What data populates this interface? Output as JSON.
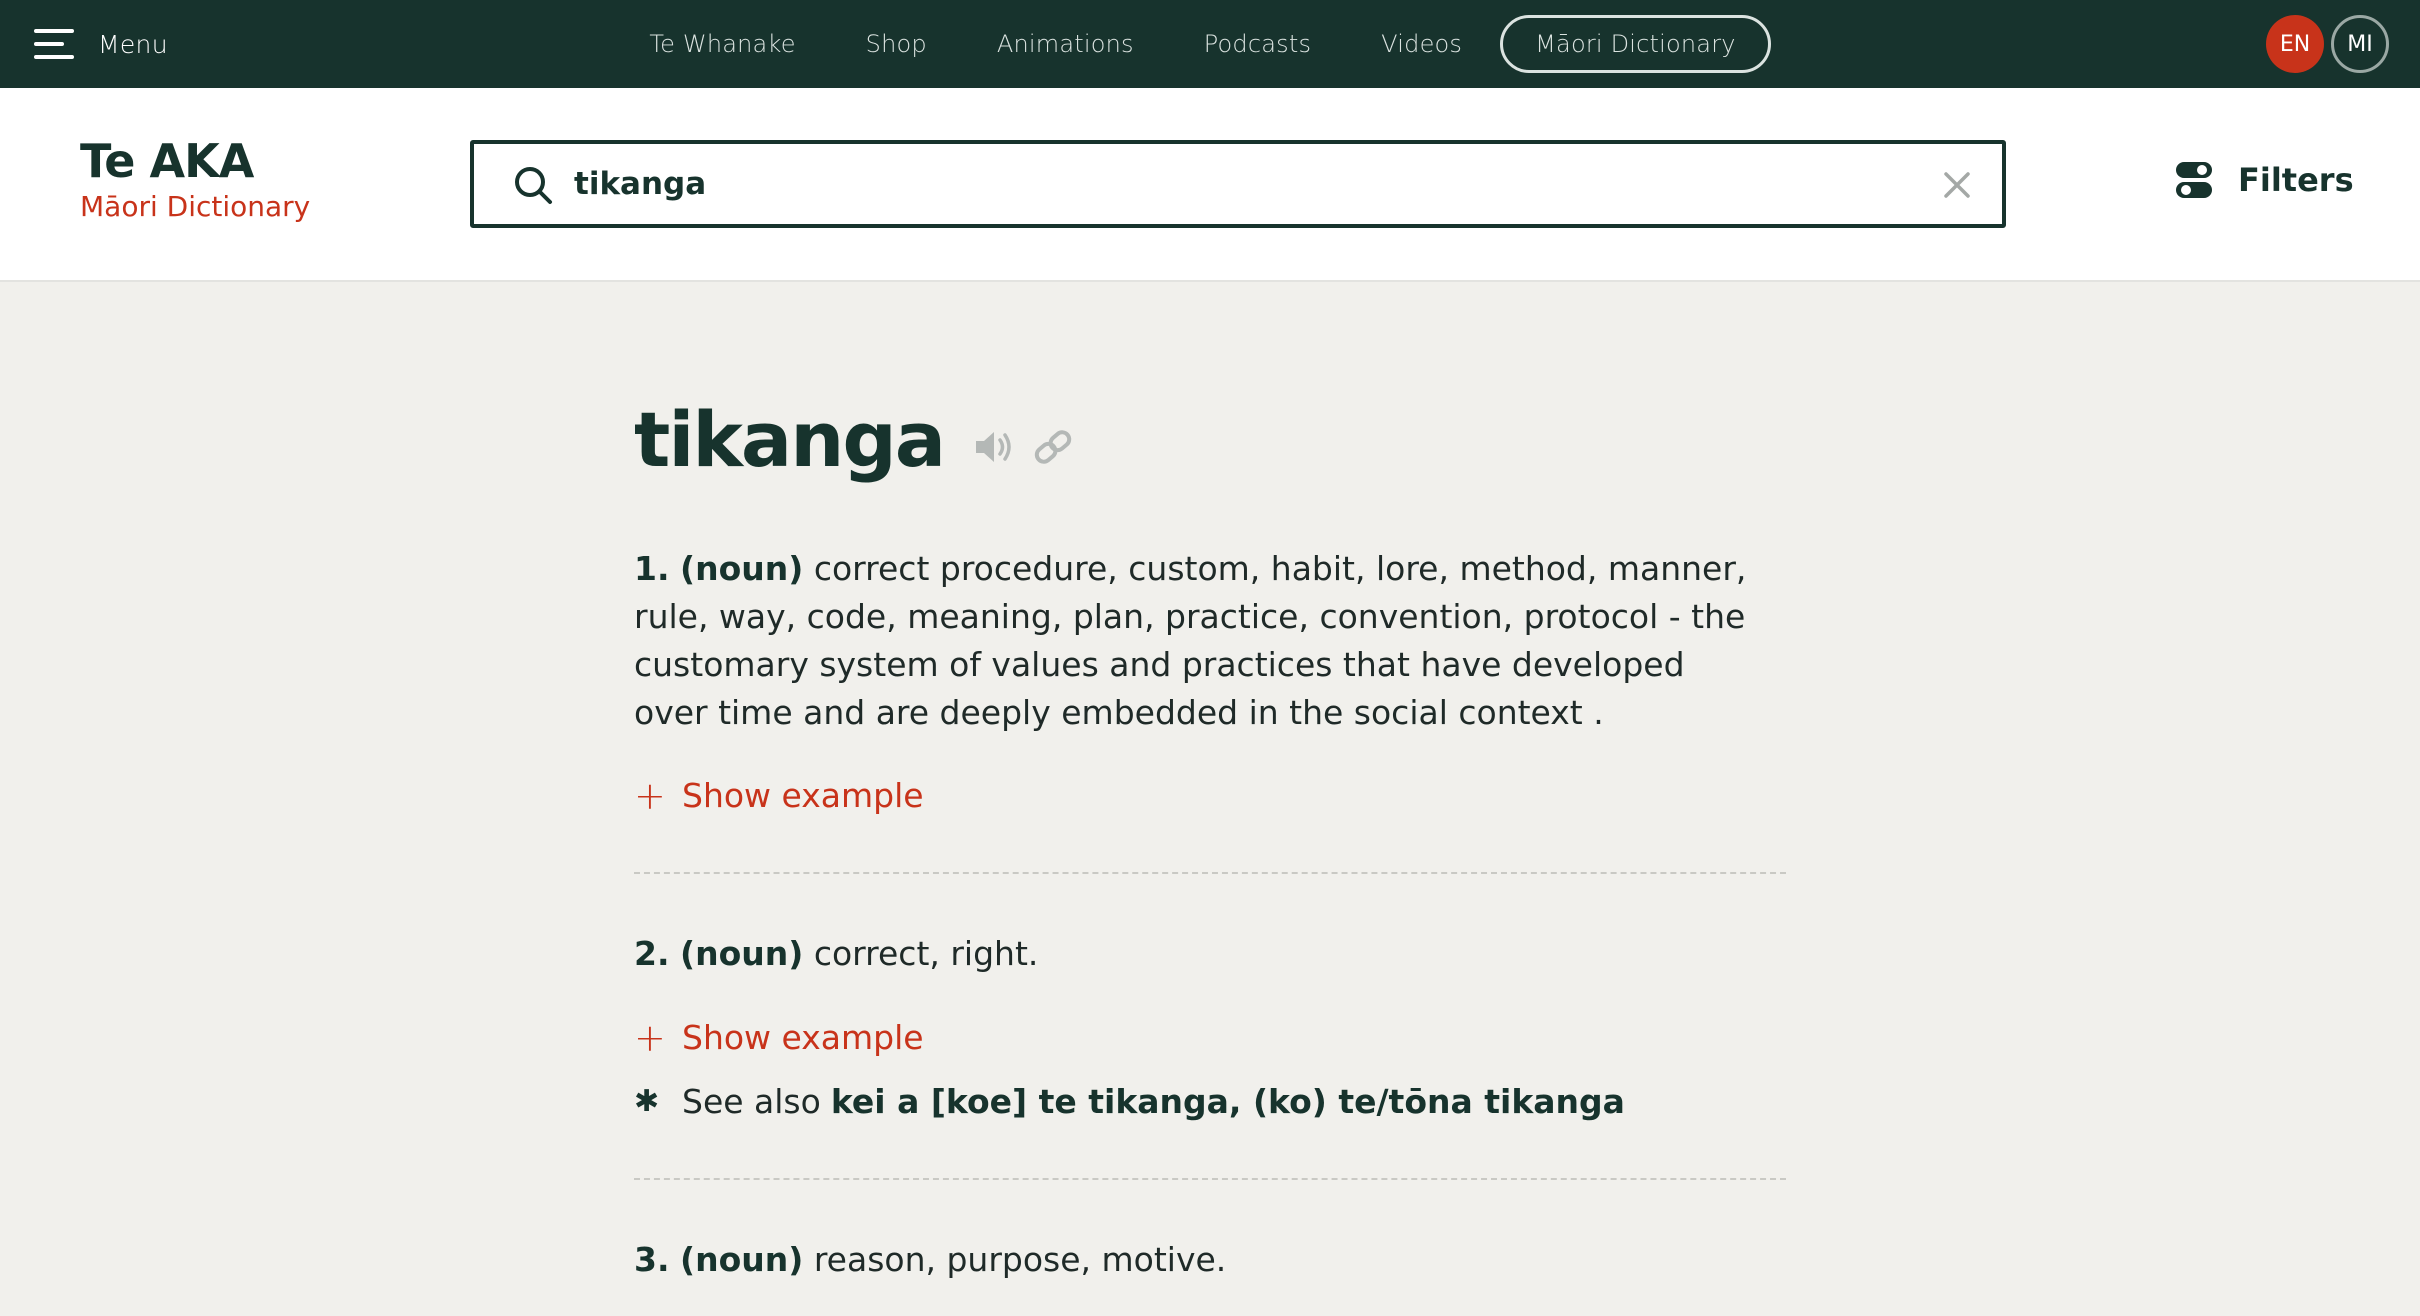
{
  "topnav": {
    "menu_label": "Menu",
    "links": [
      "Te Whanake",
      "Shop",
      "Animations",
      "Podcasts",
      "Videos"
    ],
    "dictionary_pill": "Māori Dictionary",
    "lang_en": "EN",
    "lang_mi": "MI",
    "colors": {
      "background": "#17332d",
      "active_lang": "#c8331a"
    }
  },
  "header": {
    "logo_main": "Te AKA",
    "logo_sub": "Māori Dictionary",
    "search_value": "tikanga",
    "filters_label": "Filters",
    "icons": [
      "search-icon",
      "clear-icon",
      "toggle-filters-icon"
    ]
  },
  "entry": {
    "headword": "tikanga",
    "headword_icons": [
      "speaker-icon",
      "link-icon"
    ],
    "senses": [
      {
        "number": "1.",
        "pos": "(noun)",
        "definition": "correct procedure, custom, habit, lore, method, manner, rule, way, code, meaning, plan, practice, convention, protocol - the customary system of values and practices that have developed over time and are deeply embedded in the social context .",
        "show_example": "Show example"
      },
      {
        "number": "2.",
        "pos": "(noun)",
        "definition": "correct, right.",
        "show_example": "Show example",
        "see_also_label": "See also",
        "see_also_terms": "kei a [koe] te tikanga, (ko) te/tōna tikanga"
      },
      {
        "number": "3.",
        "pos": "(noun)",
        "definition": "reason, purpose, motive."
      }
    ]
  }
}
